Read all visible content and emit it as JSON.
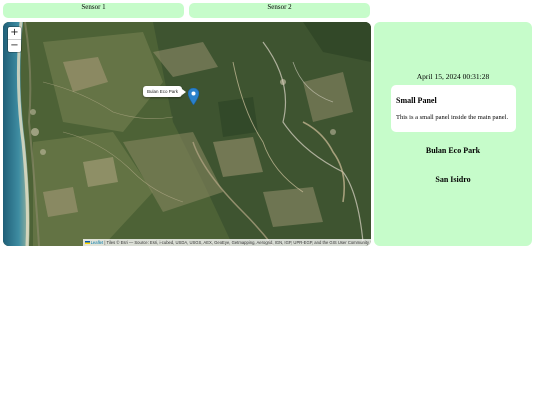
{
  "tabs": [
    {
      "label": "Sensor 1"
    },
    {
      "label": "Sensor 2"
    }
  ],
  "map": {
    "zoom_in_label": "+",
    "zoom_out_label": "−",
    "marker_tooltip": "Bulan Eco Park",
    "marker_color": "#2a81cb",
    "attribution": {
      "leaflet_label": "Leaflet",
      "text": " | Tiles © Esri — Source: Esri, i-cubed, USDA, USGS, AEX, GeoEye, Getmapping, Aerogrid, IGN, IGP, UPR-EGP, and the GIS User Community"
    }
  },
  "panel": {
    "datetime": "April 15, 2024 00:31:28",
    "small_panel": {
      "title": "Small Panel",
      "body": "This is a small panel inside the main panel."
    },
    "locations": [
      "Bulan Eco Park",
      "San Isidro"
    ]
  },
  "colors": {
    "accent_green": "#c6fcca",
    "panel_white": "#ffffff"
  }
}
